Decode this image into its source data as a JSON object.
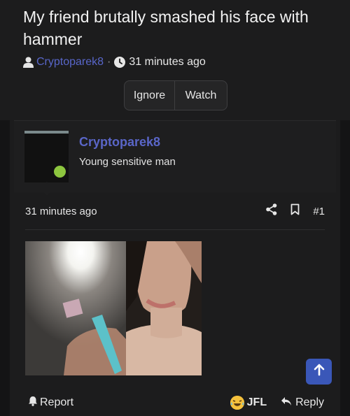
{
  "thread": {
    "title": "My friend brutally smashed his face with hammer",
    "author": "Cryptoparek8",
    "separator": "·",
    "time": "31 minutes ago"
  },
  "actions": {
    "ignore_label": "Ignore",
    "watch_label": "Watch"
  },
  "user_card": {
    "name": "Cryptoparek8",
    "user_title": "Young sensitive man",
    "online_color": "#8dc63f"
  },
  "post": {
    "time": "31 minutes ago",
    "number": "#1",
    "icons": [
      "share-icon",
      "bookmark-icon"
    ]
  },
  "attachments": [
    {
      "name": "attachment-image-1"
    },
    {
      "name": "attachment-image-2"
    }
  ],
  "footer": {
    "report_label": "Report",
    "reaction_label": "JFL",
    "reply_label": "Reply"
  },
  "colors": {
    "background": "#1c1c1d",
    "accent": "#5a66c8",
    "button_blue": "#3a57b8"
  }
}
